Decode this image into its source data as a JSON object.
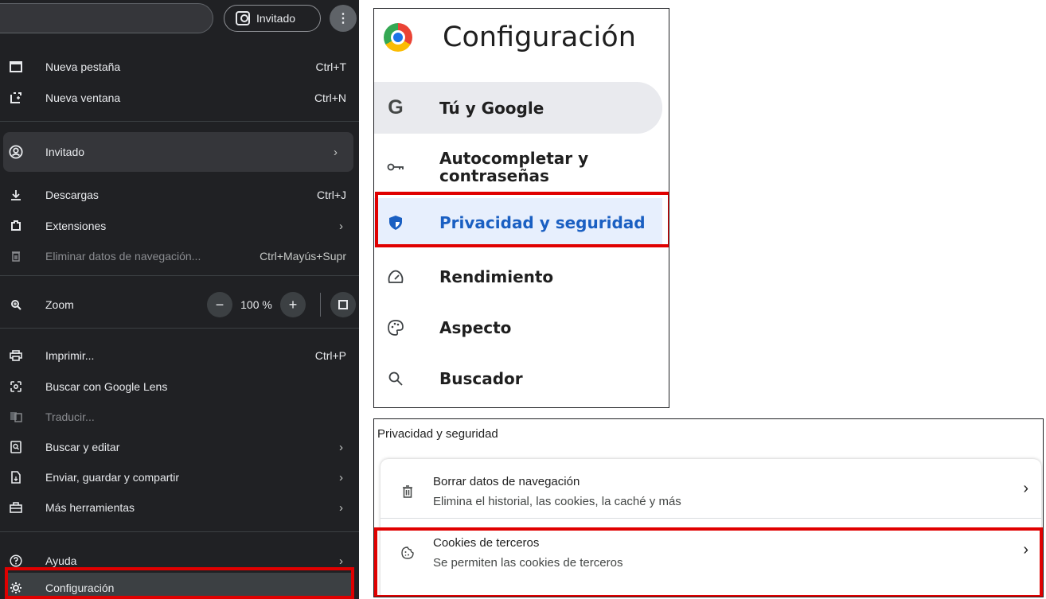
{
  "chrome_menu": {
    "profile_chip_label": "Invitado",
    "kebab_label": "⋮",
    "items": [
      {
        "label": "Nueva pestaña",
        "shortcut": "Ctrl+T",
        "icon": "new-tab-icon"
      },
      {
        "label": "Nueva ventana",
        "shortcut": "Ctrl+N",
        "icon": "new-window-icon"
      },
      {
        "label": "Invitado",
        "icon": "guest-profile-icon"
      },
      {
        "label": "Descargas",
        "shortcut": "Ctrl+J",
        "icon": "download-icon"
      },
      {
        "label": "Extensiones",
        "icon": "extensions-icon"
      },
      {
        "label": "Eliminar datos de navegación...",
        "shortcut": "Ctrl+Mayús+Supr",
        "icon": "trash-icon"
      },
      {
        "label": "Zoom",
        "icon": "zoom-icon"
      },
      {
        "label": "Imprimir...",
        "shortcut": "Ctrl+P",
        "icon": "print-icon"
      },
      {
        "label": "Buscar con Google Lens",
        "icon": "google-lens-icon"
      },
      {
        "label": "Traducir...",
        "icon": "translate-icon"
      },
      {
        "label": "Buscar y editar",
        "icon": "find-edit-icon"
      },
      {
        "label": "Enviar, guardar y compartir",
        "icon": "share-icon"
      },
      {
        "label": "Más herramientas",
        "icon": "tools-icon"
      },
      {
        "label": "Ayuda",
        "icon": "help-icon"
      },
      {
        "label": "Configuración",
        "icon": "settings-gear-icon"
      }
    ],
    "zoom": {
      "minus": "−",
      "value": "100 %",
      "plus": "+"
    },
    "arrow": "›"
  },
  "settings": {
    "title": "Configuración",
    "nav": [
      {
        "label": "Tú y Google",
        "icon": "G"
      },
      {
        "label": "Autocompletar y contraseñas",
        "icon": "key-icon"
      },
      {
        "label": "Privacidad y seguridad",
        "icon": "shield-icon"
      },
      {
        "label": "Rendimiento",
        "icon": "speedometer-icon"
      },
      {
        "label": "Aspecto",
        "icon": "palette-icon"
      },
      {
        "label": "Buscador",
        "icon": "search-icon"
      }
    ]
  },
  "privacy": {
    "heading": "Privacidad y seguridad",
    "rows": [
      {
        "title": "Borrar datos de navegación",
        "subtitle": "Elimina el historial, las cookies, la caché y más",
        "icon": "trash-icon"
      },
      {
        "title": "Cookies de terceros",
        "subtitle": "Se permiten las cookies de terceros",
        "icon": "cookie-icon"
      }
    ],
    "arrow": "›"
  },
  "highlight_color": "#e00000"
}
